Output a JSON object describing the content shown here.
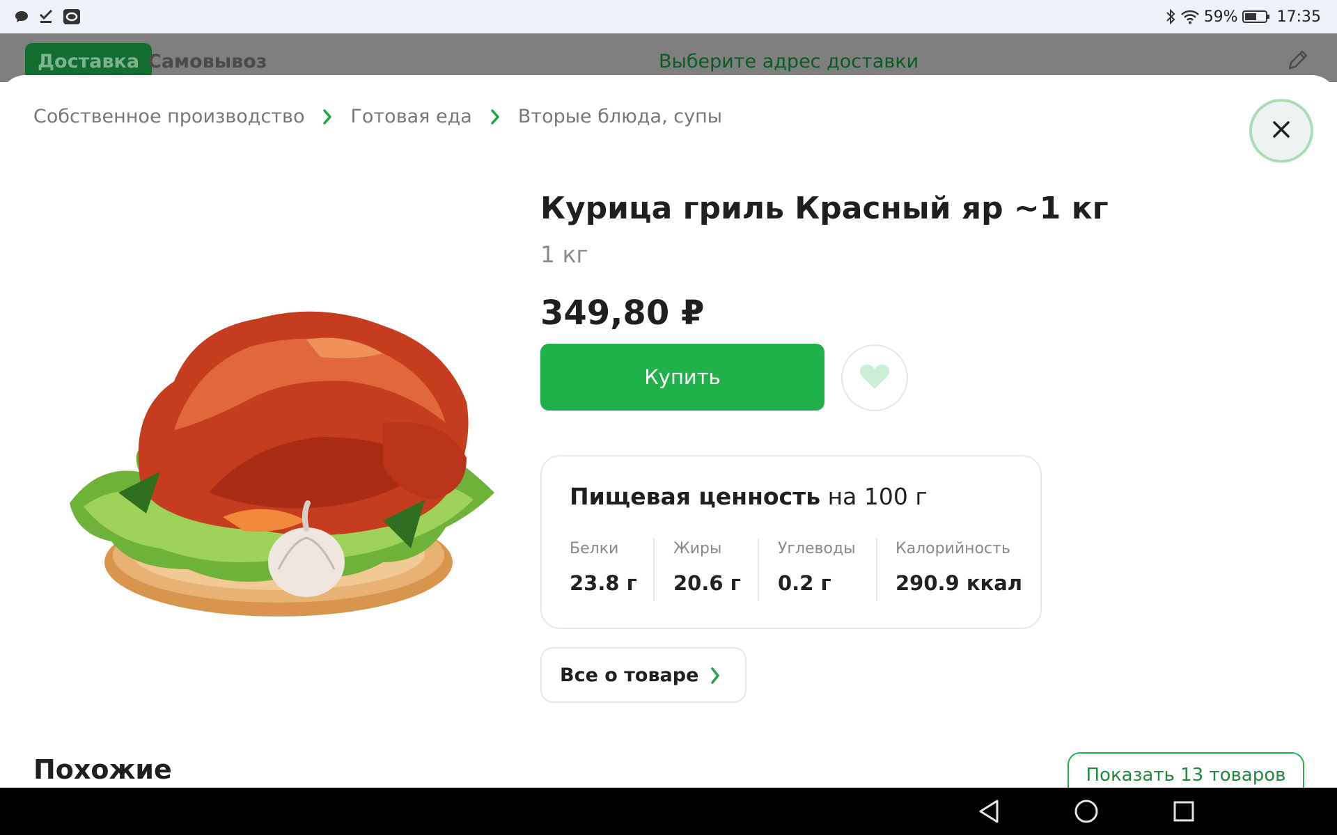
{
  "status_bar": {
    "icons": [
      "message-icon",
      "check-icon",
      "app-icon"
    ],
    "battery_percent": "59%",
    "time": "17:35",
    "right_icons": [
      "bluetooth-icon",
      "wifi-icon",
      "battery-icon"
    ]
  },
  "header": {
    "tabs": [
      {
        "label": "Доставка",
        "active": true
      },
      {
        "label": "Самовывоз",
        "active": false
      }
    ],
    "address_prompt": "Выберите адрес доставки",
    "edit_icon": "pencil-icon"
  },
  "breadcrumbs": [
    "Собственное производство",
    "Готовая еда",
    "Вторые блюда, супы"
  ],
  "product": {
    "title": "Курица гриль Красный яр ~1 кг",
    "weight": "1 кг",
    "price": "349,80 ₽",
    "buy_label": "Купить",
    "image_icon": "grilled-chicken-image"
  },
  "nutrition": {
    "title_bold": "Пищевая ценность",
    "title_rest": " на 100 г",
    "items": [
      {
        "label": "Белки",
        "value": "23.8 г"
      },
      {
        "label": "Жиры",
        "value": "20.6 г"
      },
      {
        "label": "Углеводы",
        "value": "0.2 г"
      },
      {
        "label": "Калорийность",
        "value": "290.9 ккал"
      }
    ]
  },
  "all_about_label": "Все о товаре",
  "similar": {
    "title": "Похожие",
    "show_all_label": "Показать 13 товаров"
  },
  "colors": {
    "accent_green": "#21b14a",
    "status_bg": "#eef2f8"
  }
}
